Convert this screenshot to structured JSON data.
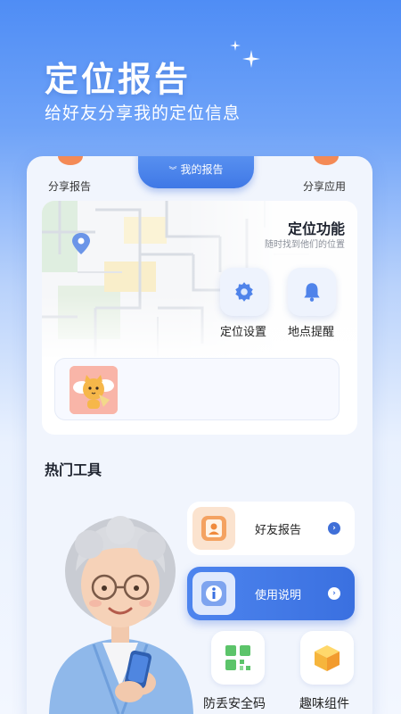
{
  "hero": {
    "title": "定位报告",
    "subtitle": "给好友分享我的定位信息"
  },
  "card_top": {
    "left_label": "分享报告",
    "tab_label": "我的报告",
    "right_label": "分享应用"
  },
  "feature": {
    "title": "定位功能",
    "subtitle": "随时找到他们的位置",
    "buttons": [
      {
        "label": "定位设置",
        "icon": "gear-icon"
      },
      {
        "label": "地点提醒",
        "icon": "bell-icon"
      }
    ]
  },
  "tools": {
    "section_title": "热门工具",
    "rows": [
      {
        "label": "好友报告",
        "icon": "friend-report-icon"
      },
      {
        "label": "使用说明",
        "icon": "info-icon"
      }
    ],
    "tiles": [
      {
        "label": "防丢安全码",
        "icon": "qr-code-icon"
      },
      {
        "label": "趣味组件",
        "icon": "box-icon"
      }
    ]
  },
  "colors": {
    "accent": "#3f78e6",
    "orange": "#f48a56"
  }
}
